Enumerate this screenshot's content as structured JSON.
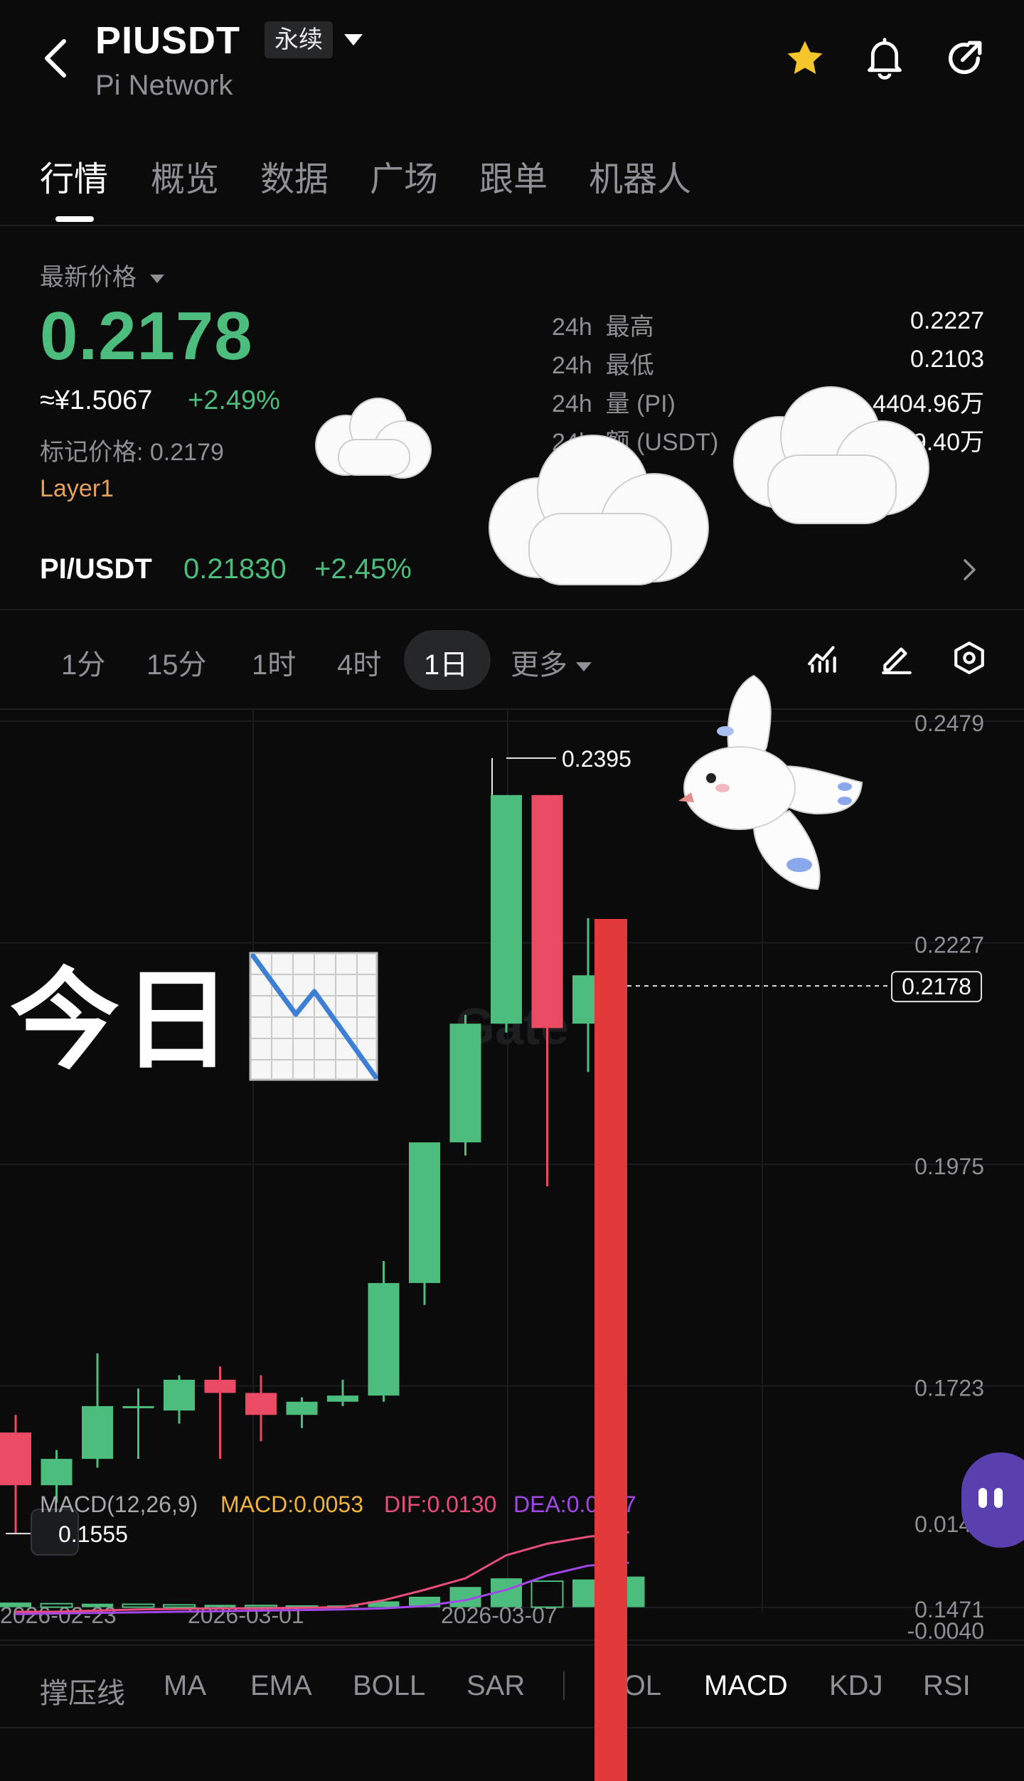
{
  "header": {
    "symbol": "PIUSDT",
    "contract_type": "永续",
    "subtitle": "Pi Network"
  },
  "tabs": [
    {
      "label": "行情",
      "active": true
    },
    {
      "label": "概览"
    },
    {
      "label": "数据"
    },
    {
      "label": "广场"
    },
    {
      "label": "跟单"
    },
    {
      "label": "机器人"
    }
  ],
  "ticker": {
    "latest_label": "最新价格",
    "price": "0.2178",
    "cny": "≈¥1.5067",
    "change": "+2.49%",
    "mark_price": "标记价格: 0.2179",
    "tag": "Layer1",
    "stats": [
      {
        "period": "24h",
        "label": "最高",
        "value": "0.2227"
      },
      {
        "period": "24h",
        "label": "最低",
        "value": "0.2103"
      },
      {
        "period": "24h",
        "label": "量 (PI)",
        "value": "4404.96万"
      },
      {
        "period": "24h",
        "label": "额 (USDT)",
        "value": "959.40万"
      }
    ]
  },
  "spot": {
    "pair": "PI/USDT",
    "price": "0.21830",
    "change": "+2.45%"
  },
  "intervals": [
    {
      "label": "1分"
    },
    {
      "label": "15分"
    },
    {
      "label": "1时"
    },
    {
      "label": "4时"
    },
    {
      "label": "1日",
      "active": true
    },
    {
      "label": "更多"
    }
  ],
  "overlay": {
    "text": "今日",
    "emoji_name": "chart-decreasing-icon"
  },
  "chart_data": {
    "type": "candlestick",
    "watermark": "Gate",
    "ylim": [
      0.1471,
      0.2479
    ],
    "y_ticks": [
      "0.2479",
      "0.2227",
      "0.1975",
      "0.1723",
      "0.1471"
    ],
    "x_ticks": [
      "2026-02-23",
      "2026-03-01",
      "2026-03-07"
    ],
    "current_price_label": "0.2178",
    "high_label": "0.2395",
    "low_label": "0.1555",
    "candles": [
      {
        "o": 0.167,
        "h": 0.169,
        "l": 0.1555,
        "c": 0.161
      },
      {
        "o": 0.161,
        "h": 0.165,
        "l": 0.159,
        "c": 0.164
      },
      {
        "o": 0.164,
        "h": 0.176,
        "l": 0.163,
        "c": 0.17
      },
      {
        "o": 0.17,
        "h": 0.172,
        "l": 0.164,
        "c": 0.17
      },
      {
        "o": 0.1695,
        "h": 0.1735,
        "l": 0.168,
        "c": 0.173
      },
      {
        "o": 0.173,
        "h": 0.1745,
        "l": 0.164,
        "c": 0.1715
      },
      {
        "o": 0.1715,
        "h": 0.1735,
        "l": 0.166,
        "c": 0.169
      },
      {
        "o": 0.169,
        "h": 0.171,
        "l": 0.1675,
        "c": 0.1705
      },
      {
        "o": 0.1705,
        "h": 0.173,
        "l": 0.17,
        "c": 0.1712
      },
      {
        "o": 0.1712,
        "h": 0.1865,
        "l": 0.1705,
        "c": 0.184
      },
      {
        "o": 0.184,
        "h": 0.199,
        "l": 0.1815,
        "c": 0.2
      },
      {
        "o": 0.2,
        "h": 0.2145,
        "l": 0.1985,
        "c": 0.2135
      },
      {
        "o": 0.2135,
        "h": 0.2395,
        "l": 0.2125,
        "c": 0.2395
      },
      {
        "o": 0.2395,
        "h": 0.2395,
        "l": 0.195,
        "c": 0.213
      },
      {
        "o": 0.2135,
        "h": 0.2255,
        "l": 0.208,
        "c": 0.219
      },
      {
        "o": 0.2178,
        "h": 0.2178,
        "l": 0.2178,
        "c": 0.2178
      }
    ],
    "macd": {
      "label": "MACD(12,26,9)",
      "macd_text": "MACD:0.0053",
      "dif_text": "DIF:0.0130",
      "dea_text": "DEA:0.0077",
      "ylim": [
        -0.004,
        0.0145
      ],
      "y_ticks": [
        "0.0145",
        "-0.0040"
      ],
      "dif": [
        -0.0008,
        -0.0008,
        -0.0006,
        -0.0004,
        -0.0003,
        -0.0002,
        -0.0002,
        -0.0001,
        0.0,
        0.0012,
        0.003,
        0.005,
        0.009,
        0.011,
        0.0122,
        0.013
      ],
      "dea": [
        -0.0012,
        -0.0011,
        -0.001,
        -0.0009,
        -0.0008,
        -0.0007,
        -0.0006,
        -0.0005,
        -0.0004,
        -0.0002,
        0.0002,
        0.0012,
        0.003,
        0.0055,
        0.0072,
        0.0077
      ],
      "hist": [
        0.0008,
        0.0006,
        0.0006,
        0.0005,
        0.0004,
        0.0004,
        0.0003,
        0.0002,
        0.0003,
        0.001,
        0.0018,
        0.0035,
        0.005,
        0.0045,
        0.0048,
        0.0053
      ]
    }
  },
  "indicator_tabs": [
    {
      "label": "撑压线"
    },
    {
      "label": "MA"
    },
    {
      "label": "EMA"
    },
    {
      "label": "BOLL"
    },
    {
      "label": "SAR"
    },
    {
      "label": "VOL"
    },
    {
      "label": "MACD",
      "active": true
    },
    {
      "label": "KDJ"
    },
    {
      "label": "RSI"
    }
  ],
  "colors": {
    "up": "#4dbd7d",
    "down": "#ea4a64",
    "accent_line": "#e23a3a",
    "star": "#f5c52b"
  }
}
